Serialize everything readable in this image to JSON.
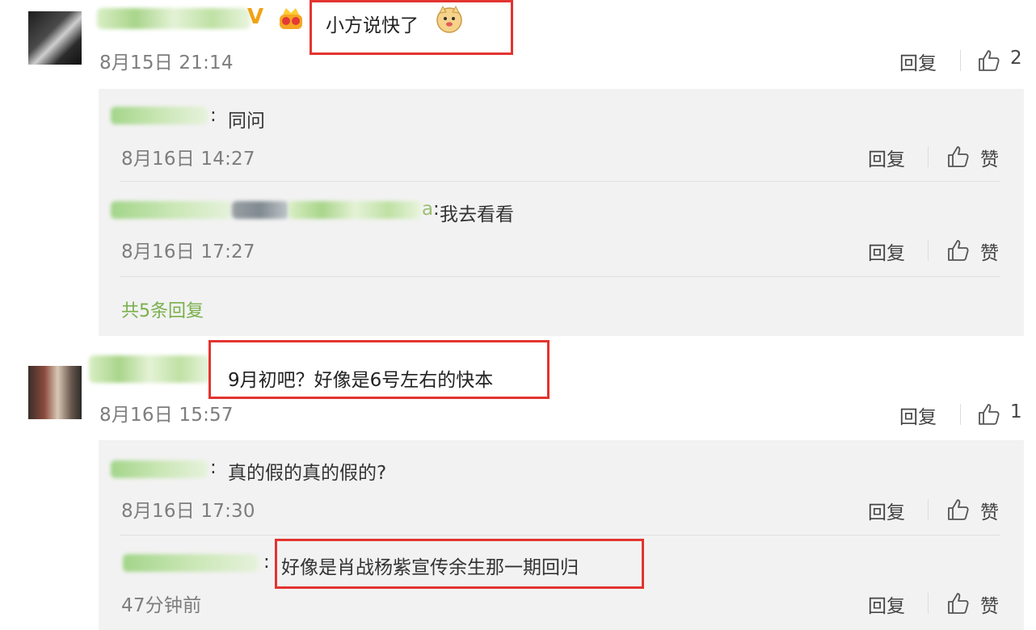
{
  "comments": [
    {
      "text": "小方说快了",
      "time": "8月15日 21:14",
      "reply_label": "回复",
      "like_count": "2",
      "badge": "V",
      "replies": [
        {
          "sep": ":",
          "text": "同问",
          "time": "8月16日 14:27",
          "reply_label": "回复",
          "like_label": "赞"
        },
        {
          "prefix": "a",
          "sep": ":",
          "text": "我去看看",
          "time": "8月16日 17:27",
          "reply_label": "回复",
          "like_label": "赞"
        }
      ],
      "total_replies": "共5条回复"
    },
    {
      "text": "9月初吧？好像是6号左右的快本",
      "time": "8月16日 15:57",
      "reply_label": "回复",
      "like_count": "1",
      "replies": [
        {
          "sep": ":",
          "text": "真的假的真的假的?",
          "time": "8月16日 17:30",
          "reply_label": "回复",
          "like_label": "赞"
        },
        {
          "sep": ":",
          "text": "好像是肖战杨紫宣传余生那一期回归",
          "time": "47分钟前",
          "reply_label": "回复",
          "like_label": "赞"
        }
      ]
    }
  ],
  "icons": {
    "like": "thumbs-up-icon",
    "verified": "verified-v-icon",
    "level": "crown-level-icon",
    "emoji": "doge-emoji-icon"
  },
  "colors": {
    "highlight_box": "#e3342f",
    "link_green": "#79b04a",
    "panel_bg": "#f2f2f2"
  }
}
